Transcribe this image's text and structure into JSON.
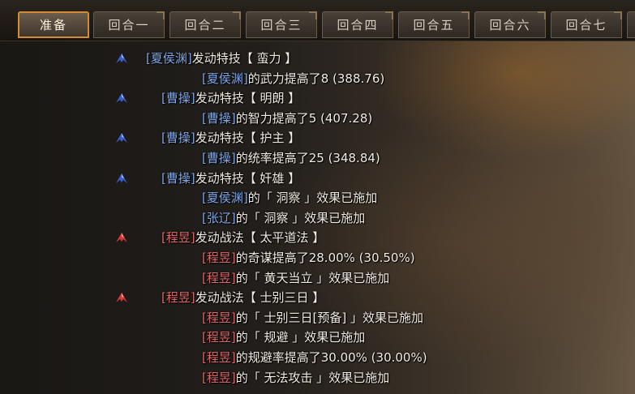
{
  "tabs": [
    "准备",
    "回合一",
    "回合二",
    "回合三",
    "回合四",
    "回合五",
    "回合六",
    "回合七"
  ],
  "active_tab": 0,
  "colors": {
    "wei_name": "#7fa7e6",
    "enemy_name": "#e0686a",
    "accent": "#d58b36",
    "text": "#f2ece2"
  },
  "log": [
    {
      "arrow": "blue-arrow-icon",
      "name": "[夏侯渊]",
      "side": "wei",
      "text": "发动特技【 蛮力 】"
    },
    {
      "name": "[夏侯渊]",
      "side": "wei",
      "text": "的武力提高了8 (388.76)"
    },
    {
      "arrow": "blue-arrow-icon",
      "name": "[曹操]",
      "side": "wei",
      "text": "发动特技【 明朗 】"
    },
    {
      "name": "[曹操]",
      "side": "wei",
      "text": "的智力提高了5 (407.28)"
    },
    {
      "arrow": "blue-arrow-icon",
      "name": "[曹操]",
      "side": "wei",
      "text": "发动特技【 护主 】"
    },
    {
      "name": "[曹操]",
      "side": "wei",
      "text": "的统率提高了25 (348.84)"
    },
    {
      "arrow": "blue-arrow-icon",
      "name": "[曹操]",
      "side": "wei",
      "text": "发动特技【 奸雄 】"
    },
    {
      "name": "[夏侯渊]",
      "side": "wei",
      "text": "的「 洞察 」效果已施加"
    },
    {
      "name": "[张辽]",
      "side": "wei",
      "text": "的「 洞察 」效果已施加"
    },
    {
      "arrow": "red-arrow-icon",
      "name": "[程昱]",
      "side": "enemy",
      "text": "发动战法【 太平道法 】"
    },
    {
      "name": "[程昱]",
      "side": "enemy",
      "text": "的奇谋提高了28.00% (30.50%)"
    },
    {
      "name": "[程昱]",
      "side": "enemy",
      "text": "的「 黄天当立 」效果已施加"
    },
    {
      "arrow": "red-arrow-icon",
      "name": "[程昱]",
      "side": "enemy",
      "text": "发动战法【 士别三日 】"
    },
    {
      "name": "[程昱]",
      "side": "enemy",
      "text": "的「 士别三日[预备] 」效果已施加"
    },
    {
      "name": "[程昱]",
      "side": "enemy",
      "text": "的「 规避 」效果已施加"
    },
    {
      "name": "[程昱]",
      "side": "enemy",
      "text": "的规避率提高了30.00% (30.00%)"
    },
    {
      "name": "[程昱]",
      "side": "enemy",
      "text": "的「 无法攻击 」效果已施加"
    }
  ]
}
